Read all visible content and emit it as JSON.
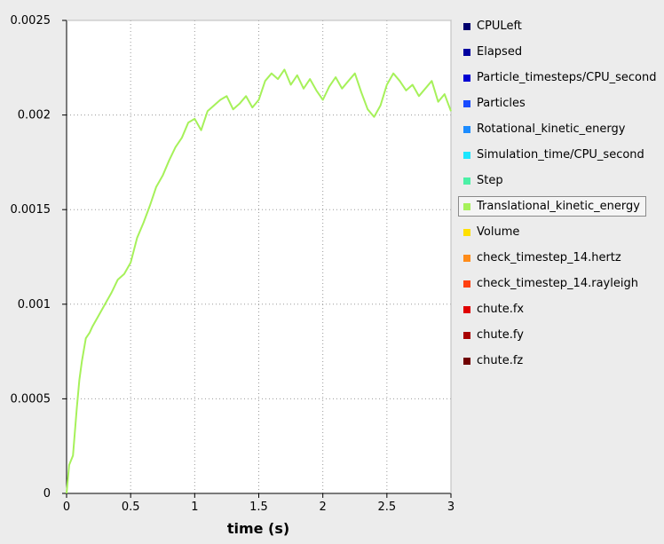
{
  "chart_data": {
    "type": "line",
    "xlabel": "time (s)",
    "ylabel": "",
    "xlim": [
      0,
      3
    ],
    "ylim": [
      0,
      0.0025
    ],
    "grid": true,
    "legend_position": "right",
    "x_ticks": [
      0,
      0.5,
      1,
      1.5,
      2,
      2.5,
      3
    ],
    "x_tick_labels": [
      "0",
      "0.5",
      "1",
      "1.5",
      "2",
      "2.5",
      "3"
    ],
    "y_ticks": [
      0,
      0.0005,
      0.001,
      0.0015,
      0.002,
      0.0025
    ],
    "y_tick_labels": [
      "0",
      "0.0005",
      "0.001",
      "0.0015",
      "0.002",
      "0.0025"
    ],
    "series": [
      {
        "name": "Translational_kinetic_energy",
        "color": "#a6f15a",
        "x": [
          0,
          0.02,
          0.05,
          0.08,
          0.1,
          0.12,
          0.15,
          0.18,
          0.2,
          0.25,
          0.3,
          0.35,
          0.4,
          0.45,
          0.5,
          0.55,
          0.6,
          0.65,
          0.7,
          0.75,
          0.8,
          0.85,
          0.9,
          0.95,
          1.0,
          1.05,
          1.1,
          1.15,
          1.2,
          1.25,
          1.3,
          1.35,
          1.4,
          1.45,
          1.5,
          1.55,
          1.6,
          1.65,
          1.7,
          1.75,
          1.8,
          1.85,
          1.9,
          1.95,
          2.0,
          2.05,
          2.1,
          2.15,
          2.2,
          2.25,
          2.3,
          2.35,
          2.4,
          2.45,
          2.5,
          2.55,
          2.6,
          2.65,
          2.7,
          2.75,
          2.8,
          2.85,
          2.9,
          2.95,
          3.0
        ],
        "values": [
          0,
          0.00015,
          0.0002,
          0.00045,
          0.0006,
          0.0007,
          0.00082,
          0.00085,
          0.00088,
          0.00094,
          0.001,
          0.00106,
          0.00113,
          0.00116,
          0.00122,
          0.00135,
          0.00143,
          0.00152,
          0.00162,
          0.00168,
          0.00176,
          0.00183,
          0.00188,
          0.00196,
          0.00198,
          0.00192,
          0.00202,
          0.00205,
          0.00208,
          0.0021,
          0.00203,
          0.00206,
          0.0021,
          0.00204,
          0.00208,
          0.00218,
          0.00222,
          0.00219,
          0.00224,
          0.00216,
          0.00221,
          0.00214,
          0.00219,
          0.00213,
          0.00208,
          0.00215,
          0.0022,
          0.00214,
          0.00218,
          0.00222,
          0.00212,
          0.00203,
          0.00199,
          0.00205,
          0.00216,
          0.00222,
          0.00218,
          0.00213,
          0.00216,
          0.0021,
          0.00214,
          0.00218,
          0.00207,
          0.00211,
          0.00202
        ]
      }
    ]
  },
  "legend": {
    "items": [
      {
        "label": "CPULeft",
        "color": "#00006e"
      },
      {
        "label": "Elapsed",
        "color": "#0000a0"
      },
      {
        "label": "Particle_timesteps/CPU_second",
        "color": "#0000d2"
      },
      {
        "label": "Particles",
        "color": "#1a4cff"
      },
      {
        "label": "Rotational_kinetic_energy",
        "color": "#1c8cff"
      },
      {
        "label": "Simulation_time/CPU_second",
        "color": "#1ce6ff"
      },
      {
        "label": "Step",
        "color": "#4cf0a6"
      },
      {
        "label": "Translational_kinetic_energy",
        "color": "#a6f15a",
        "selected": true
      },
      {
        "label": "Volume",
        "color": "#ffe000"
      },
      {
        "label": "check_timestep_14.hertz",
        "color": "#ff8c1a"
      },
      {
        "label": "check_timestep_14.rayleigh",
        "color": "#ff4010"
      },
      {
        "label": "chute.fx",
        "color": "#e00000"
      },
      {
        "label": "chute.fy",
        "color": "#a80000"
      },
      {
        "label": "chute.fz",
        "color": "#700000"
      }
    ]
  }
}
